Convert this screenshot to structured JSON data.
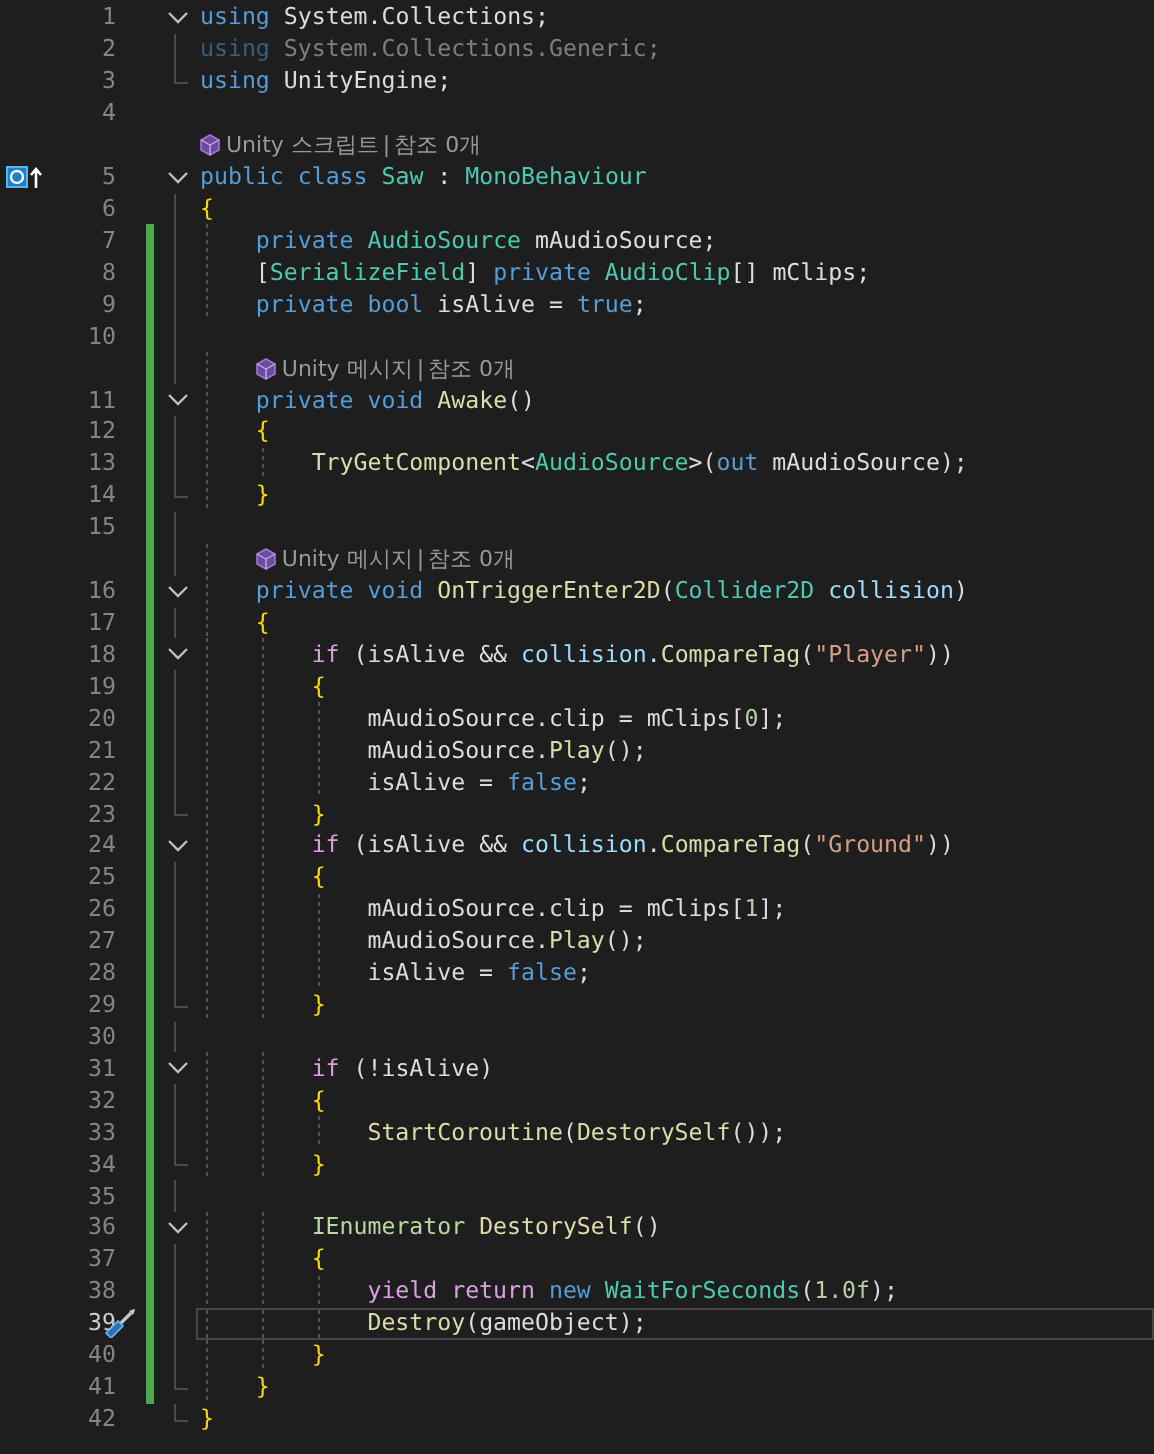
{
  "editor": {
    "rows": [
      {
        "kind": "code",
        "number": "1",
        "fold_start": true,
        "fold_end": false,
        "changed": false,
        "indent": "",
        "tokens": [
          {
            "text": "using",
            "kind": "kw"
          },
          {
            "text": " System.Collections;",
            "kind": "plain"
          }
        ]
      },
      {
        "kind": "code",
        "number": "2",
        "fold_start": false,
        "fold_end": false,
        "changed": false,
        "indent": "",
        "faded": true,
        "tokens": [
          {
            "text": "using",
            "kind": "kw"
          },
          {
            "text": " System.Collections.Generic;",
            "kind": "plain"
          }
        ]
      },
      {
        "kind": "code",
        "number": "3",
        "fold_start": false,
        "fold_end": true,
        "changed": false,
        "indent": "",
        "tokens": [
          {
            "text": "using",
            "kind": "kw"
          },
          {
            "text": " UnityEngine;",
            "kind": "plain"
          }
        ]
      },
      {
        "kind": "code",
        "number": "4",
        "fold_start": false,
        "fold_end": false,
        "changed": false,
        "indent": "",
        "tokens": []
      },
      {
        "kind": "codelens",
        "fold_start": false,
        "fold_end": false,
        "changed": false,
        "indent": "",
        "items": [
          "Unity 스크립트",
          "참조 0개"
        ],
        "separator": "|"
      },
      {
        "kind": "code",
        "number": "5",
        "fold_start": true,
        "fold_end": false,
        "implementation_marker": true,
        "changed": false,
        "indent": "",
        "tokens": [
          {
            "text": "public class",
            "kind": "kw"
          },
          {
            "text": " Saw",
            "kind": "type"
          },
          {
            "text": " : ",
            "kind": "plain"
          },
          {
            "text": "MonoBehaviour",
            "kind": "type"
          }
        ]
      },
      {
        "kind": "code",
        "number": "6",
        "fold_start": false,
        "fold_end": false,
        "changed": false,
        "indent": "",
        "tokens": [
          {
            "text": "{",
            "kind": "brace"
          }
        ]
      },
      {
        "kind": "code",
        "number": "7",
        "fold_start": false,
        "fold_end": false,
        "changed": true,
        "indent": "    ",
        "tokens": [
          {
            "text": "private",
            "kind": "kw"
          },
          {
            "text": " AudioSource",
            "kind": "type"
          },
          {
            "text": " mAudioSource;",
            "kind": "plain"
          }
        ]
      },
      {
        "kind": "code",
        "number": "8",
        "fold_start": false,
        "fold_end": false,
        "changed": true,
        "indent": "    ",
        "tokens": [
          {
            "text": "[",
            "kind": "plain"
          },
          {
            "text": "SerializeField",
            "kind": "type"
          },
          {
            "text": "]",
            "kind": "plain"
          },
          {
            "text": " private",
            "kind": "kw"
          },
          {
            "text": " AudioClip",
            "kind": "type"
          },
          {
            "text": "[] mClips;",
            "kind": "plain"
          }
        ]
      },
      {
        "kind": "code",
        "number": "9",
        "fold_start": false,
        "fold_end": false,
        "changed": true,
        "indent": "    ",
        "tokens": [
          {
            "text": "private bool",
            "kind": "kw"
          },
          {
            "text": " isAlive = ",
            "kind": "plain"
          },
          {
            "text": "true",
            "kind": "kw"
          },
          {
            "text": ";",
            "kind": "plain"
          }
        ]
      },
      {
        "kind": "code",
        "number": "10",
        "fold_start": false,
        "fold_end": false,
        "changed": true,
        "indent": "",
        "tokens": []
      },
      {
        "kind": "codelens",
        "fold_start": false,
        "fold_end": false,
        "changed": true,
        "indent": "    ",
        "items": [
          "Unity 메시지",
          "참조 0개"
        ],
        "separator": "|"
      },
      {
        "kind": "code",
        "number": "11",
        "fold_start": true,
        "fold_end": false,
        "changed": true,
        "indent": "    ",
        "tokens": [
          {
            "text": "private void",
            "kind": "kw"
          },
          {
            "text": " Awake",
            "kind": "fn"
          },
          {
            "text": "()",
            "kind": "plain"
          }
        ]
      },
      {
        "kind": "code",
        "number": "12",
        "fold_start": false,
        "fold_end": false,
        "changed": true,
        "indent": "    ",
        "tokens": [
          {
            "text": "{",
            "kind": "brace"
          }
        ]
      },
      {
        "kind": "code",
        "number": "13",
        "fold_start": false,
        "fold_end": false,
        "changed": true,
        "indent": "        ",
        "tokens": [
          {
            "text": "TryGetComponent",
            "kind": "fn"
          },
          {
            "text": "<",
            "kind": "plain"
          },
          {
            "text": "AudioSource",
            "kind": "type"
          },
          {
            "text": ">(",
            "kind": "plain"
          },
          {
            "text": "out",
            "kind": "kw"
          },
          {
            "text": " mAudioSource);",
            "kind": "plain"
          }
        ]
      },
      {
        "kind": "code",
        "number": "14",
        "fold_start": false,
        "fold_end": true,
        "changed": true,
        "indent": "    ",
        "tokens": [
          {
            "text": "}",
            "kind": "brace"
          }
        ]
      },
      {
        "kind": "code",
        "number": "15",
        "fold_start": false,
        "fold_end": false,
        "changed": true,
        "indent": "",
        "tokens": []
      },
      {
        "kind": "codelens",
        "fold_start": false,
        "fold_end": false,
        "changed": true,
        "indent": "    ",
        "items": [
          "Unity 메시지",
          "참조 0개"
        ],
        "separator": "|"
      },
      {
        "kind": "code",
        "number": "16",
        "fold_start": true,
        "fold_end": false,
        "changed": true,
        "indent": "    ",
        "tokens": [
          {
            "text": "private void",
            "kind": "kw"
          },
          {
            "text": " OnTriggerEnter2D",
            "kind": "fn"
          },
          {
            "text": "(",
            "kind": "plain"
          },
          {
            "text": "Collider2D",
            "kind": "type"
          },
          {
            "text": " collision",
            "kind": "param"
          },
          {
            "text": ")",
            "kind": "plain"
          }
        ]
      },
      {
        "kind": "code",
        "number": "17",
        "fold_start": false,
        "fold_end": false,
        "changed": true,
        "indent": "    ",
        "tokens": [
          {
            "text": "{",
            "kind": "brace"
          }
        ]
      },
      {
        "kind": "code",
        "number": "18",
        "fold_start": true,
        "fold_end": false,
        "changed": true,
        "indent": "        ",
        "tokens": [
          {
            "text": "if",
            "kind": "ctl"
          },
          {
            "text": " (isAlive && ",
            "kind": "plain"
          },
          {
            "text": "collision",
            "kind": "param"
          },
          {
            "text": ".",
            "kind": "plain"
          },
          {
            "text": "CompareTag",
            "kind": "fn"
          },
          {
            "text": "(",
            "kind": "plain"
          },
          {
            "text": "\"Player\"",
            "kind": "str"
          },
          {
            "text": "))",
            "kind": "plain"
          }
        ]
      },
      {
        "kind": "code",
        "number": "19",
        "fold_start": false,
        "fold_end": false,
        "changed": true,
        "indent": "        ",
        "tokens": [
          {
            "text": "{",
            "kind": "brace"
          }
        ]
      },
      {
        "kind": "code",
        "number": "20",
        "fold_start": false,
        "fold_end": false,
        "changed": true,
        "indent": "            ",
        "tokens": [
          {
            "text": "mAudioSource.clip = mClips[",
            "kind": "plain"
          },
          {
            "text": "0",
            "kind": "num"
          },
          {
            "text": "];",
            "kind": "plain"
          }
        ]
      },
      {
        "kind": "code",
        "number": "21",
        "fold_start": false,
        "fold_end": false,
        "changed": true,
        "indent": "            ",
        "tokens": [
          {
            "text": "mAudioSource.",
            "kind": "plain"
          },
          {
            "text": "Play",
            "kind": "fn"
          },
          {
            "text": "();",
            "kind": "plain"
          }
        ]
      },
      {
        "kind": "code",
        "number": "22",
        "fold_start": false,
        "fold_end": false,
        "changed": true,
        "indent": "            ",
        "tokens": [
          {
            "text": "isAlive = ",
            "kind": "plain"
          },
          {
            "text": "false",
            "kind": "kw"
          },
          {
            "text": ";",
            "kind": "plain"
          }
        ]
      },
      {
        "kind": "code",
        "number": "23",
        "fold_start": false,
        "fold_end": true,
        "changed": true,
        "indent": "        ",
        "tokens": [
          {
            "text": "}",
            "kind": "brace"
          }
        ]
      },
      {
        "kind": "code",
        "number": "24",
        "fold_start": true,
        "fold_end": false,
        "changed": true,
        "indent": "        ",
        "tokens": [
          {
            "text": "if",
            "kind": "ctl"
          },
          {
            "text": " (isAlive && ",
            "kind": "plain"
          },
          {
            "text": "collision",
            "kind": "param"
          },
          {
            "text": ".",
            "kind": "plain"
          },
          {
            "text": "CompareTag",
            "kind": "fn"
          },
          {
            "text": "(",
            "kind": "plain"
          },
          {
            "text": "\"Ground\"",
            "kind": "str"
          },
          {
            "text": "))",
            "kind": "plain"
          }
        ]
      },
      {
        "kind": "code",
        "number": "25",
        "fold_start": false,
        "fold_end": false,
        "changed": true,
        "indent": "        ",
        "tokens": [
          {
            "text": "{",
            "kind": "brace"
          }
        ]
      },
      {
        "kind": "code",
        "number": "26",
        "fold_start": false,
        "fold_end": false,
        "changed": true,
        "indent": "            ",
        "tokens": [
          {
            "text": "mAudioSource.clip = mClips[",
            "kind": "plain"
          },
          {
            "text": "1",
            "kind": "num"
          },
          {
            "text": "];",
            "kind": "plain"
          }
        ]
      },
      {
        "kind": "code",
        "number": "27",
        "fold_start": false,
        "fold_end": false,
        "changed": true,
        "indent": "            ",
        "tokens": [
          {
            "text": "mAudioSource.",
            "kind": "plain"
          },
          {
            "text": "Play",
            "kind": "fn"
          },
          {
            "text": "();",
            "kind": "plain"
          }
        ]
      },
      {
        "kind": "code",
        "number": "28",
        "fold_start": false,
        "fold_end": false,
        "changed": true,
        "indent": "            ",
        "tokens": [
          {
            "text": "isAlive = ",
            "kind": "plain"
          },
          {
            "text": "false",
            "kind": "kw"
          },
          {
            "text": ";",
            "kind": "plain"
          }
        ]
      },
      {
        "kind": "code",
        "number": "29",
        "fold_start": false,
        "fold_end": true,
        "changed": true,
        "indent": "        ",
        "tokens": [
          {
            "text": "}",
            "kind": "brace"
          }
        ]
      },
      {
        "kind": "code",
        "number": "30",
        "fold_start": false,
        "fold_end": false,
        "changed": true,
        "indent": "",
        "tokens": []
      },
      {
        "kind": "code",
        "number": "31",
        "fold_start": true,
        "fold_end": false,
        "changed": true,
        "indent": "        ",
        "tokens": [
          {
            "text": "if",
            "kind": "ctl"
          },
          {
            "text": " (!isAlive)",
            "kind": "plain"
          }
        ]
      },
      {
        "kind": "code",
        "number": "32",
        "fold_start": false,
        "fold_end": false,
        "changed": true,
        "indent": "        ",
        "tokens": [
          {
            "text": "{",
            "kind": "brace"
          }
        ]
      },
      {
        "kind": "code",
        "number": "33",
        "fold_start": false,
        "fold_end": false,
        "changed": true,
        "indent": "            ",
        "tokens": [
          {
            "text": "StartCoroutine",
            "kind": "fn"
          },
          {
            "text": "(",
            "kind": "plain"
          },
          {
            "text": "DestorySelf",
            "kind": "fn"
          },
          {
            "text": "());",
            "kind": "plain"
          }
        ]
      },
      {
        "kind": "code",
        "number": "34",
        "fold_start": false,
        "fold_end": true,
        "changed": true,
        "indent": "        ",
        "tokens": [
          {
            "text": "}",
            "kind": "brace"
          }
        ]
      },
      {
        "kind": "code",
        "number": "35",
        "fold_start": false,
        "fold_end": false,
        "changed": true,
        "indent": "",
        "tokens": []
      },
      {
        "kind": "code",
        "number": "36",
        "fold_start": true,
        "fold_end": false,
        "changed": true,
        "indent": "        ",
        "tokens": [
          {
            "text": "IEnumerator",
            "kind": "iface"
          },
          {
            "text": " DestorySelf",
            "kind": "fn"
          },
          {
            "text": "()",
            "kind": "plain"
          }
        ]
      },
      {
        "kind": "code",
        "number": "37",
        "fold_start": false,
        "fold_end": false,
        "changed": true,
        "indent": "        ",
        "tokens": [
          {
            "text": "{",
            "kind": "brace"
          }
        ]
      },
      {
        "kind": "code",
        "number": "38",
        "fold_start": false,
        "fold_end": false,
        "changed": true,
        "indent": "            ",
        "tokens": [
          {
            "text": "yield return",
            "kind": "ctl"
          },
          {
            "text": " new",
            "kind": "kw"
          },
          {
            "text": " WaitForSeconds",
            "kind": "type"
          },
          {
            "text": "(",
            "kind": "plain"
          },
          {
            "text": "1.0f",
            "kind": "num"
          },
          {
            "text": ");",
            "kind": "plain"
          }
        ]
      },
      {
        "kind": "code",
        "number": "39",
        "fold_start": false,
        "fold_end": false,
        "quick_action": true,
        "current": true,
        "changed": true,
        "indent": "            ",
        "tokens": [
          {
            "text": "Destroy",
            "kind": "fn"
          },
          {
            "text": "(gameObject);",
            "kind": "plain"
          }
        ]
      },
      {
        "kind": "code",
        "number": "40",
        "fold_start": false,
        "fold_end": false,
        "changed": true,
        "indent": "        ",
        "tokens": [
          {
            "text": "}",
            "kind": "brace"
          }
        ]
      },
      {
        "kind": "code",
        "number": "41",
        "fold_start": false,
        "fold_end": true,
        "changed": true,
        "indent": "    ",
        "tokens": [
          {
            "text": "}",
            "kind": "brace"
          }
        ]
      },
      {
        "kind": "code",
        "number": "42",
        "fold_start": false,
        "fold_end": true,
        "changed": false,
        "indent": "",
        "tokens": [
          {
            "text": "}",
            "kind": "brace"
          }
        ]
      }
    ]
  }
}
